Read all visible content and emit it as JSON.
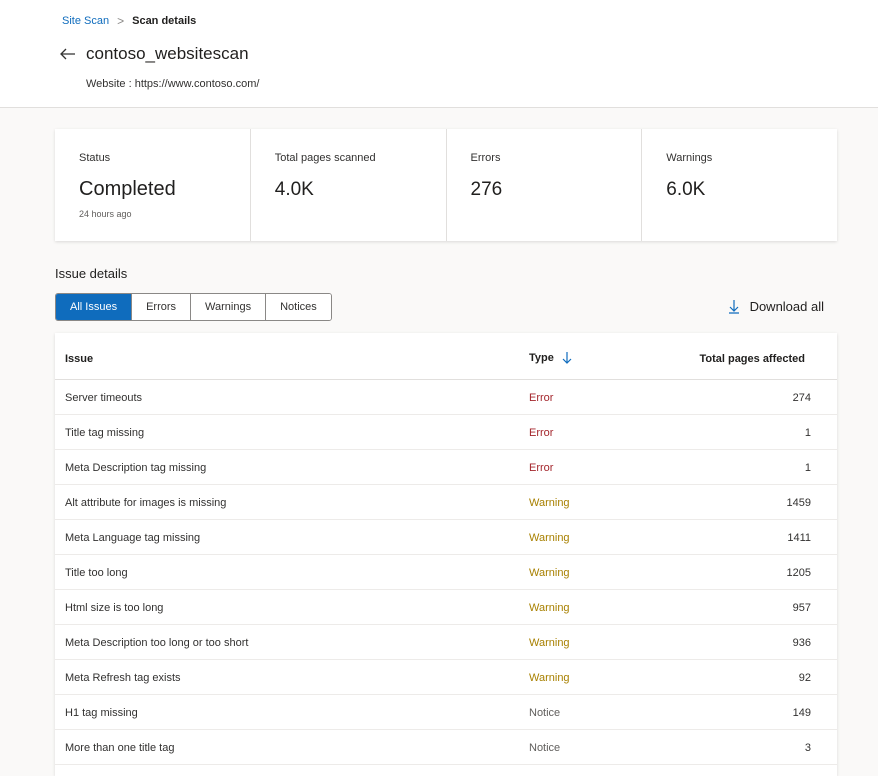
{
  "breadcrumb": {
    "parent": "Site Scan",
    "separator": ">",
    "current": "Scan details"
  },
  "header": {
    "title": "contoso_websitescan",
    "website": "Website : https://www.contoso.com/"
  },
  "stats": [
    {
      "label": "Status",
      "value": "Completed",
      "sub": "24 hours ago"
    },
    {
      "label": "Total pages scanned",
      "value": "4.0K"
    },
    {
      "label": "Errors",
      "value": "276"
    },
    {
      "label": "Warnings",
      "value": "6.0K"
    }
  ],
  "issues": {
    "title": "Issue details",
    "filters": [
      "All Issues",
      "Errors",
      "Warnings",
      "Notices"
    ],
    "active_filter": "All Issues",
    "download_label": "Download all",
    "columns": {
      "issue": "Issue",
      "type": "Type",
      "total": "Total pages affected"
    },
    "rows": [
      {
        "issue": "Server timeouts",
        "type": "Error",
        "count": "274"
      },
      {
        "issue": "Title tag missing",
        "type": "Error",
        "count": "1"
      },
      {
        "issue": "Meta Description tag missing",
        "type": "Error",
        "count": "1"
      },
      {
        "issue": "Alt attribute for images is missing",
        "type": "Warning",
        "count": "1459"
      },
      {
        "issue": "Meta Language tag missing",
        "type": "Warning",
        "count": "1411"
      },
      {
        "issue": "Title too long",
        "type": "Warning",
        "count": "1205"
      },
      {
        "issue": "Html size is too long",
        "type": "Warning",
        "count": "957"
      },
      {
        "issue": "Meta Description too long or too short",
        "type": "Warning",
        "count": "936"
      },
      {
        "issue": "Meta Refresh tag exists",
        "type": "Warning",
        "count": "92"
      },
      {
        "issue": "H1 tag missing",
        "type": "Notice",
        "count": "149"
      },
      {
        "issue": "More than one title tag",
        "type": "Notice",
        "count": "3"
      }
    ]
  },
  "colors": {
    "accent": "#0f6cbd",
    "error": "#a4262c",
    "warning": "#a88000",
    "notice": "#605e5c"
  },
  "icons": {
    "back": "arrow-left-icon",
    "download": "arrow-down-icon",
    "sort": "sort-down-icon"
  }
}
